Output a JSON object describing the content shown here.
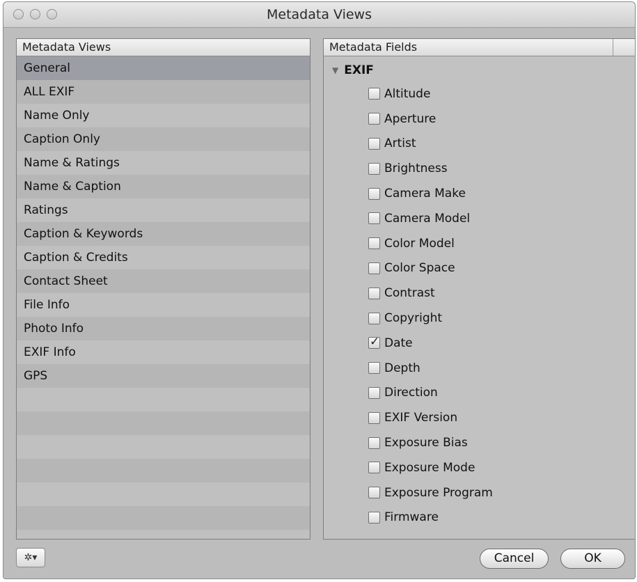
{
  "window": {
    "title": "Metadata Views"
  },
  "left_panel": {
    "header": "Metadata Views",
    "items": [
      {
        "label": "General",
        "selected": true
      },
      {
        "label": "ALL EXIF"
      },
      {
        "label": "Name Only"
      },
      {
        "label": "Caption Only"
      },
      {
        "label": "Name & Ratings"
      },
      {
        "label": "Name & Caption"
      },
      {
        "label": "Ratings"
      },
      {
        "label": "Caption & Keywords"
      },
      {
        "label": "Caption & Credits"
      },
      {
        "label": "Contact Sheet"
      },
      {
        "label": "File Info"
      },
      {
        "label": "Photo Info"
      },
      {
        "label": "EXIF Info"
      },
      {
        "label": "GPS"
      },
      {
        "label": ""
      },
      {
        "label": ""
      },
      {
        "label": ""
      },
      {
        "label": ""
      },
      {
        "label": ""
      },
      {
        "label": ""
      },
      {
        "label": ""
      }
    ]
  },
  "right_panel": {
    "header": "Metadata Fields",
    "group": {
      "label": "EXIF",
      "expanded": true
    },
    "fields": [
      {
        "label": "Altitude",
        "checked": false
      },
      {
        "label": "Aperture",
        "checked": false
      },
      {
        "label": "Artist",
        "checked": false
      },
      {
        "label": "Brightness",
        "checked": false
      },
      {
        "label": "Camera Make",
        "checked": false
      },
      {
        "label": "Camera Model",
        "checked": false
      },
      {
        "label": "Color Model",
        "checked": false
      },
      {
        "label": "Color Space",
        "checked": false
      },
      {
        "label": "Contrast",
        "checked": false
      },
      {
        "label": "Copyright",
        "checked": false
      },
      {
        "label": "Date",
        "checked": true
      },
      {
        "label": "Depth",
        "checked": false
      },
      {
        "label": "Direction",
        "checked": false
      },
      {
        "label": "EXIF Version",
        "checked": false
      },
      {
        "label": "Exposure Bias",
        "checked": false
      },
      {
        "label": "Exposure Mode",
        "checked": false
      },
      {
        "label": "Exposure Program",
        "checked": false
      },
      {
        "label": "Firmware",
        "checked": false
      }
    ]
  },
  "footer": {
    "gear_icon": "gear-icon",
    "cancel_label": "Cancel",
    "ok_label": "OK"
  }
}
